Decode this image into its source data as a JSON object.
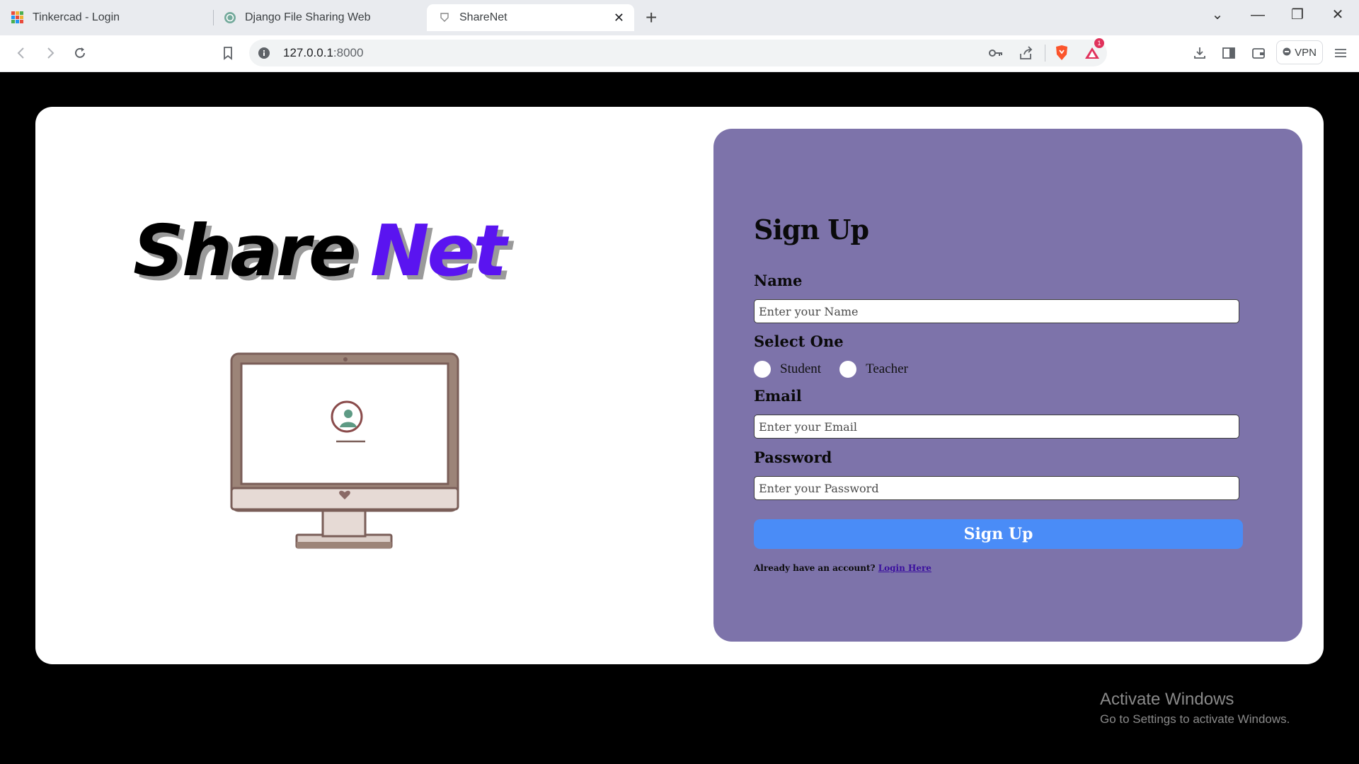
{
  "browser": {
    "tabs": [
      {
        "title": "Tinkercad - Login",
        "active": false
      },
      {
        "title": "Django File Sharing Web",
        "active": false
      },
      {
        "title": "ShareNet",
        "active": true
      }
    ],
    "url_host": "127.0.0.1",
    "url_port": ":8000",
    "vpn_label": "VPN",
    "notification_badge": "1"
  },
  "brand": {
    "part1": "Share",
    "part2": "Net",
    "accent_color": "#5a14f0"
  },
  "form": {
    "title": "Sign Up",
    "name_label": "Name",
    "name_placeholder": "Enter your Name",
    "select_label": "Select One",
    "role_options": [
      "Student",
      "Teacher"
    ],
    "email_label": "Email",
    "email_placeholder": "Enter your Email",
    "password_label": "Password",
    "password_placeholder": "Enter your Password",
    "submit_label": "Sign Up",
    "account_prompt": "Already have an account?",
    "login_link": "Login Here",
    "panel_color": "#7d73aa",
    "button_color": "#4a8cf7"
  },
  "os_watermark": {
    "line1": "Activate Windows",
    "line2": "Go to Settings to activate Windows."
  }
}
